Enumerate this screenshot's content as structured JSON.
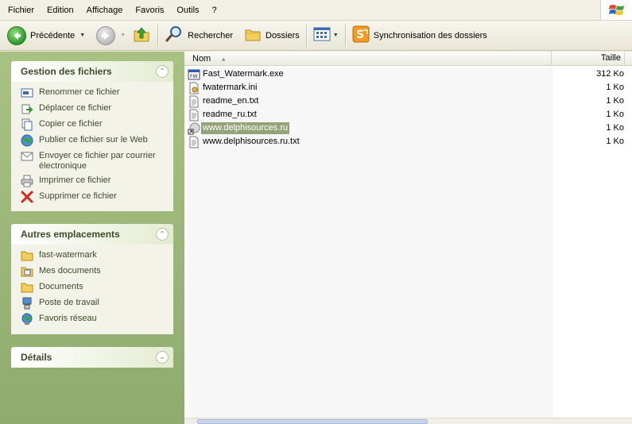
{
  "menu": {
    "items": [
      "Fichier",
      "Edition",
      "Affichage",
      "Favoris",
      "Outils",
      "?"
    ]
  },
  "toolbar": {
    "back_label": "Précédente",
    "search_label": "Rechercher",
    "folders_label": "Dossiers",
    "sync_label": "Synchronisation des dossiers"
  },
  "file_tasks": {
    "title": "Gestion des fichiers",
    "items": [
      {
        "label": "Renommer ce fichier",
        "icon": "rename-icon"
      },
      {
        "label": "Déplacer ce fichier",
        "icon": "move-icon"
      },
      {
        "label": "Copier ce fichier",
        "icon": "copy-icon"
      },
      {
        "label": "Publier ce fichier sur le Web",
        "icon": "web-publish-icon"
      },
      {
        "label": "Envoyer ce fichier par courrier électronique",
        "icon": "email-icon"
      },
      {
        "label": "Imprimer ce fichier",
        "icon": "printer-icon"
      },
      {
        "label": "Supprimer ce fichier",
        "icon": "delete-icon"
      }
    ]
  },
  "other_places": {
    "title": "Autres emplacements",
    "items": [
      {
        "label": "fast-watermark",
        "icon": "folder-icon"
      },
      {
        "label": "Mes documents",
        "icon": "my-documents-icon"
      },
      {
        "label": "Documents",
        "icon": "folder-icon"
      },
      {
        "label": "Poste de travail",
        "icon": "my-computer-icon"
      },
      {
        "label": "Favoris réseau",
        "icon": "network-places-icon"
      }
    ]
  },
  "details": {
    "title": "Détails"
  },
  "file_list": {
    "columns": {
      "name": "Nom",
      "size": "Taille"
    },
    "sort_column": "Nom",
    "selected_index": 4,
    "files": [
      {
        "name": "Fast_Watermark.exe",
        "size": "312 Ko",
        "icon": "exe-icon"
      },
      {
        "name": "fwatermark.ini",
        "size": "1 Ko",
        "icon": "ini-icon"
      },
      {
        "name": "readme_en.txt",
        "size": "1 Ko",
        "icon": "text-file-icon"
      },
      {
        "name": "readme_ru.txt",
        "size": "1 Ko",
        "icon": "text-file-icon"
      },
      {
        "name": "www.delphisources.ru",
        "size": "1 Ko",
        "icon": "shortcut-icon"
      },
      {
        "name": "www.delphisources.ru.txt",
        "size": "1 Ko",
        "icon": "text-file-icon"
      }
    ]
  },
  "colors": {
    "task_pane_bg": "#a9c284",
    "panel_bg": "#f3f3e9",
    "selection": "#94a47a",
    "task_text": "#3e4a2c"
  }
}
